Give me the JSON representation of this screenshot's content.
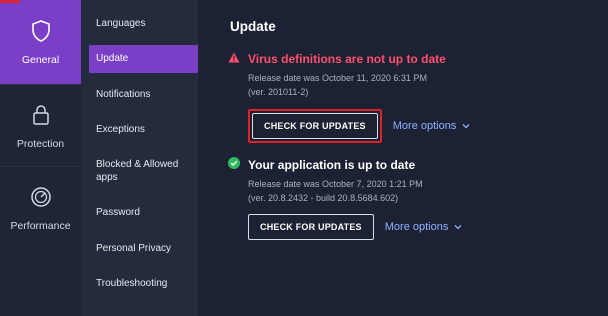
{
  "rail": {
    "items": [
      {
        "label": "General",
        "icon": "shield-icon",
        "active": true
      },
      {
        "label": "Protection",
        "icon": "lock-icon",
        "active": false
      },
      {
        "label": "Performance",
        "icon": "speedometer-icon",
        "active": false
      }
    ]
  },
  "subnav": {
    "items": [
      {
        "label": "Languages"
      },
      {
        "label": "Update",
        "active": true
      },
      {
        "label": "Notifications"
      },
      {
        "label": "Exceptions"
      },
      {
        "label": "Blocked & Allowed apps"
      },
      {
        "label": "Password"
      },
      {
        "label": "Personal Privacy"
      },
      {
        "label": "Troubleshooting"
      }
    ]
  },
  "main": {
    "title": "Update",
    "virus_definitions": {
      "status": "Virus definitions are not up to date",
      "release": "Release date was October 11, 2020 6:31 PM",
      "version": "(ver. 201011-2)",
      "button": "CHECK FOR UPDATES",
      "more": "More options"
    },
    "application": {
      "status": "Your application is up to date",
      "release": "Release date was October 7, 2020 1:21 PM",
      "version": "(ver. 20.8.2432 - build 20.8.5684.602)",
      "button": "CHECK FOR UPDATES",
      "more": "More options"
    }
  },
  "colors": {
    "accent": "#7b3fc7",
    "warning": "#ff4f6d",
    "ok": "#2dbb5c",
    "link": "#8fb2ff",
    "highlight_box": "#e0202a"
  }
}
